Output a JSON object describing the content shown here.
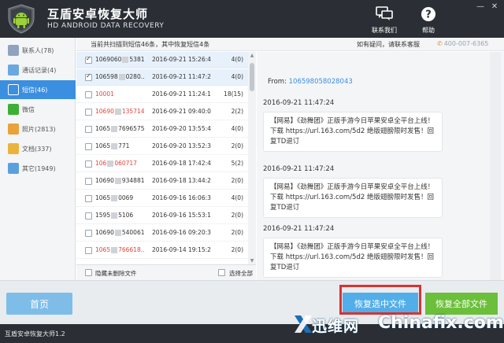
{
  "app": {
    "title": "互盾安卓恢复大师",
    "subtitle": "HD ANDROID DATA RECOVERY",
    "version": "互盾安卓恢复大师1.2"
  },
  "header": {
    "contact_label": "联系我们",
    "help_label": "帮助"
  },
  "window_controls": {
    "minimize": "—",
    "close": "✕"
  },
  "sidebar": {
    "items": [
      {
        "label": "联系人(78)",
        "icon": "contacts-icon",
        "color": "#8fa3bf"
      },
      {
        "label": "通话记录(4)",
        "icon": "call-log-icon",
        "color": "#6aa8e0"
      },
      {
        "label": "短信(46)",
        "icon": "sms-icon",
        "color": "#ffffff",
        "active": true
      },
      {
        "label": "微信",
        "icon": "wechat-icon",
        "color": "#3cb034"
      },
      {
        "label": "照片(2813)",
        "icon": "photo-icon",
        "color": "#e8a33a"
      },
      {
        "label": "文档(337)",
        "icon": "document-icon",
        "color": "#e9b43c"
      },
      {
        "label": "其它(1949)",
        "icon": "other-icon",
        "color": "#5aa0dd"
      }
    ]
  },
  "info": {
    "scan_text": "当前共扫描到短信46条，其中恢复短信4条",
    "help_text": "如有疑问，请联系客服",
    "phone": "400-007-6365"
  },
  "messages": [
    {
      "number": "1069060",
      "number_end": "5381",
      "time": "2016-09-21 15:26:4",
      "count": "4(0)",
      "checked": true,
      "red": false,
      "selected": true
    },
    {
      "number": "106598",
      "number_end": "0280...",
      "time": "2016-09-21 11:47:2",
      "count": "4(0)",
      "checked": true,
      "red": false,
      "selected": true
    },
    {
      "number": "10001",
      "number_end": "",
      "time": "2016-09-21 11:24:1",
      "count": "18(15)",
      "checked": false,
      "red": true,
      "selected": false
    },
    {
      "number": "10690",
      "number_end": "135714",
      "time": "2016-09-21 09:40:0",
      "count": "2(2)",
      "checked": false,
      "red": true,
      "selected": false
    },
    {
      "number": "1065",
      "number_end": "7696575",
      "time": "2016-09-20 13:55:4",
      "count": "4(0)",
      "checked": false,
      "red": false,
      "selected": false
    },
    {
      "number": "1065",
      "number_end": "771",
      "time": "2016-09-20 13:52:3",
      "count": "2(0)",
      "checked": false,
      "red": false,
      "selected": false
    },
    {
      "number": "106",
      "number_end": "060717",
      "time": "2016-09-18 17:42:4",
      "count": "5(2)",
      "checked": false,
      "red": true,
      "selected": false
    },
    {
      "number": "10690",
      "number_end": "9348811...",
      "time": "2016-09-18 13:44:2",
      "count": "2(0)",
      "checked": false,
      "red": false,
      "selected": false
    },
    {
      "number": "1065",
      "number_end": "0069",
      "time": "2016-09-16 16:06:3",
      "count": "4(0)",
      "checked": false,
      "red": false,
      "selected": false
    },
    {
      "number": "1595",
      "number_end": "5106",
      "time": "2016-09-16 15:53:1",
      "count": "2(0)",
      "checked": false,
      "red": false,
      "selected": false
    },
    {
      "number": "10690",
      "number_end": "5400618",
      "time": "2016-09-16 09:20:3",
      "count": "2(0)",
      "checked": false,
      "red": false,
      "selected": false
    },
    {
      "number": "1065",
      "number_end": "766618...",
      "time": "2016-09-14 19:15:2",
      "count": "2(0)",
      "checked": false,
      "red": true,
      "selected": false
    }
  ],
  "list_footer": {
    "hide_undeleted": "隐藏未删除文件",
    "select_all": "选择全部"
  },
  "detail": {
    "from_label": "From:",
    "from_number": "106598058028043",
    "entries": [
      {
        "time": "2016-09-21 11:47:24",
        "text": "【网易】《劲舞团》正版手游今日苹果安卓全平台上线！下载 https://url.163.com/5d2 绝版翅膀限时发售！回复TD退订"
      },
      {
        "time": "2016-09-21 11:47:24",
        "text": "【网易】《劲舞团》正版手游今日苹果安卓全平台上线！下载 https://url.163.com/5d2 绝版翅膀限时发售！回复TD退订"
      },
      {
        "time": "2016-09-21 11:47:24",
        "text": "【网易】《劲舞团》正版手游今日苹果安卓全平台上线！下载 https://url.163.com/5d2 绝版翅膀限时发售！回复TD退订"
      }
    ]
  },
  "buttons": {
    "home": "首页",
    "recover_selected": "恢复选中文件",
    "recover_all": "恢复全部文件"
  },
  "watermark": {
    "cn": "迅维网",
    "en": "Chinafix.com"
  },
  "colors": {
    "titlebar": "#2b2f35",
    "accent": "#3b8fe0",
    "recover_selected": "#52aee8",
    "recover_all": "#6bbf3a",
    "highlight_frame": "#d8332f"
  }
}
